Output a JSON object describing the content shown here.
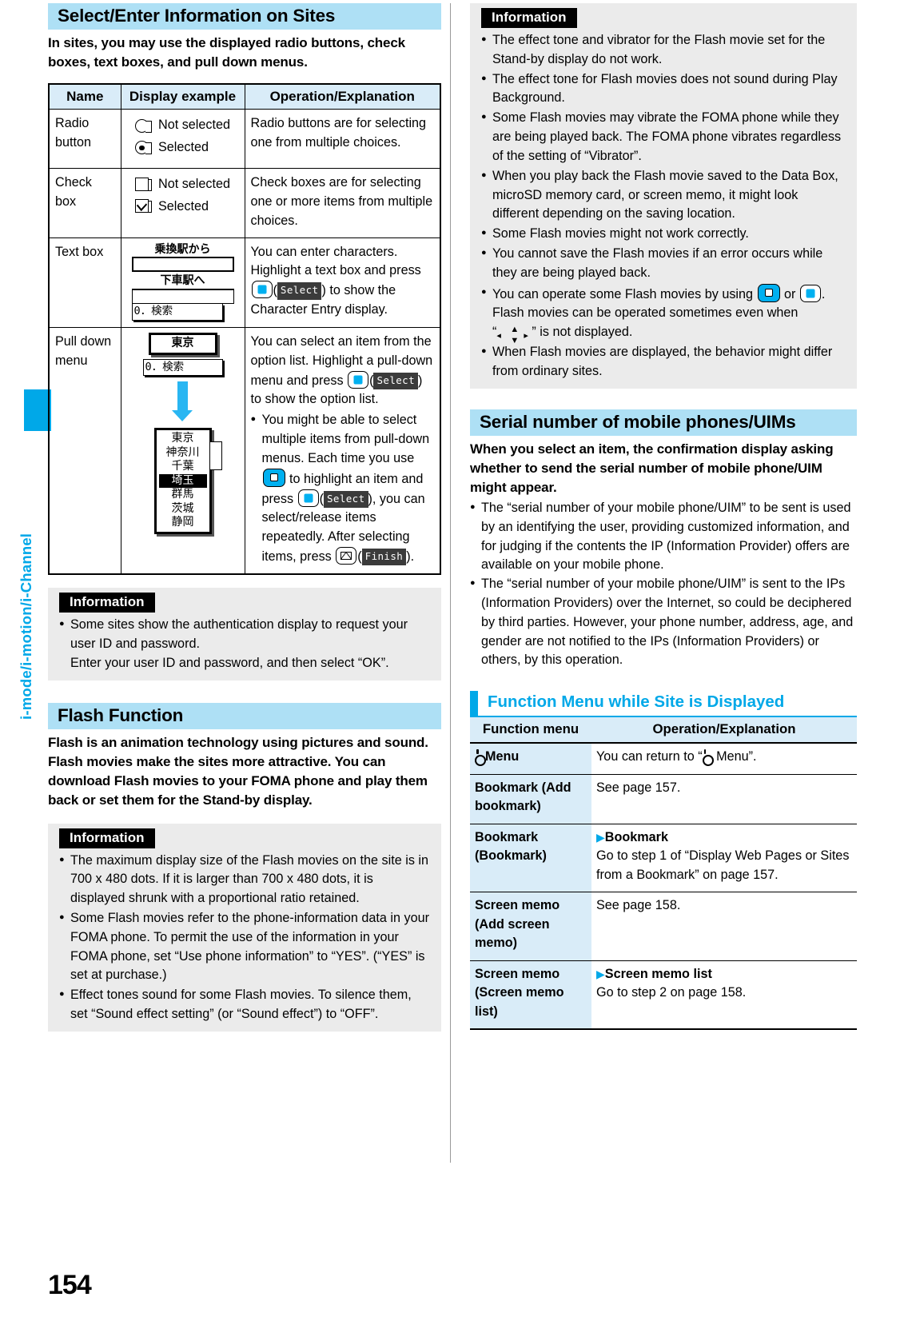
{
  "sidebar": {
    "chapter_label": "i-mode/i-motion/i-Channel",
    "accent_color": "#00a8e8"
  },
  "page_number": "154",
  "left_column": {
    "section1": {
      "heading": "Select/Enter Information on Sites",
      "lead": "In sites, you may use the displayed radio buttons, check boxes, text boxes, and pull down menus.",
      "table": {
        "headers": [
          "Name",
          "Display example",
          "Operation/Explanation"
        ],
        "rows": [
          {
            "name": "Radio button",
            "display_labels": [
              "Not selected",
              "Selected"
            ],
            "explanation": "Radio buttons are for selecting one from multiple choices."
          },
          {
            "name": "Check box",
            "display_labels": [
              "Not selected",
              "Selected"
            ],
            "explanation": "Check boxes are for selecting one or more items from multiple choices."
          },
          {
            "name": "Text box",
            "mock": {
              "label1": "乗換駅から",
              "label2": "下車駅へ",
              "button": "0．検索"
            },
            "explanation_1": "You can enter characters. Highlight a text box and press ",
            "softkey": "Select",
            "explanation_2": ") to show the Character Entry display."
          },
          {
            "name": "Pull down menu",
            "mock": {
              "selected": "東京",
              "button": "0．検索",
              "options": [
                "東京",
                "神奈川",
                "千葉",
                "埼玉",
                "群馬",
                "茨城",
                "静岡"
              ],
              "highlighted": "埼玉"
            },
            "explanation_1": "You can select an item from the option list. Highlight a pull-down menu and press ",
            "softkey_select": "Select",
            "explanation_2": ") to show the option list.",
            "bullet_1": "You might be able to select multiple items from pull-down menus. Each time you use ",
            "bullet_2": " to highlight an item and press ",
            "bullet_3": "), you can select/release items repeatedly. After selecting items, press ",
            "softkey_finish": "Finish",
            "bullet_4": ")."
          }
        ]
      },
      "information": {
        "tag": "Information",
        "items": [
          "Some sites show the authentication display to request your user ID and password.",
          "Enter your user ID and password, and then select “OK”."
        ]
      }
    },
    "section2": {
      "heading": "Flash Function",
      "lead": "Flash is an animation technology using pictures and sound. Flash movies make the sites more attractive. You can download Flash movies to your FOMA phone and play them back or set them for the Stand-by display.",
      "information": {
        "tag": "Information",
        "items": [
          "The maximum display size of the Flash movies on the site is in 700 x 480 dots. If it is larger than 700 x 480 dots, it is displayed shrunk with a proportional ratio retained.",
          "Some Flash movies refer to the phone-information data in your FOMA phone. To permit the use of the information in your FOMA phone, set “Use phone information” to “YES”. (“YES” is set at purchase.)",
          "Effect tones sound for some Flash movies. To silence them, set “Sound effect setting” (or “Sound effect”) to “OFF”."
        ]
      }
    }
  },
  "right_column": {
    "information": {
      "tag": "Information",
      "items": [
        "The effect tone and vibrator for the Flash movie set for the Stand-by display do not work.",
        "The effect tone for Flash movies does not sound during Play Background.",
        "Some Flash movies may vibrate the FOMA phone while they are being played back. The FOMA phone vibrates regardless of the setting of “Vibrator”.",
        "When you play back the Flash movie saved to the Data Box, microSD memory card, or screen memo, it might look different depending on the saving location.",
        "Some Flash movies might not work correctly.",
        "You cannot save the Flash movies if an error occurs while they are being played back.",
        "When Flash movies are displayed, the behavior might differ from ordinary sites."
      ],
      "flash_operate": {
        "part1": "You can operate some Flash movies by using ",
        "part2": " or ",
        "part3": ".",
        "part4": "Flash movies can be operated sometimes even when",
        "part5": "“",
        "part6": "” is not displayed."
      }
    },
    "section_serial": {
      "heading": "Serial number of mobile phones/UIMs",
      "lead": "When you select an item, the confirmation display asking whether to send the serial number of mobile phone/UIM might appear.",
      "bullets": [
        "The “serial number of your mobile phone/UIM” to be sent is used by an identifying the user, providing customized information, and for judging if the contents the IP (Information Provider) offers are available on your mobile phone.",
        "The “serial number of your mobile phone/UIM” is sent to the IPs (Information Providers) over the Internet, so could be deciphered by third parties. However, your phone number, address, age, and gender are not notified to the IPs (Information Providers) or others, by this operation."
      ]
    },
    "function_menu": {
      "heading": "Function Menu while Site is Displayed",
      "headers": [
        "Function menu",
        "Operation/Explanation"
      ],
      "rows": [
        {
          "menu_icon": "imenu-icon",
          "menu": "Menu",
          "op_pre": "You can return to “",
          "op_post": " Menu”."
        },
        {
          "menu": "Bookmark (Add bookmark)",
          "op": "See page 157."
        },
        {
          "menu": "Bookmark (Bookmark)",
          "op_bold": "Bookmark",
          "op": "Go to step 1 of “Display Web Pages or Sites from a Bookmark” on page 157."
        },
        {
          "menu": "Screen memo (Add screen memo)",
          "op": "See page 158."
        },
        {
          "menu": "Screen memo (Screen memo list)",
          "op_bold": "Screen memo list",
          "op": "Go to step 2 on page 158."
        }
      ]
    }
  }
}
